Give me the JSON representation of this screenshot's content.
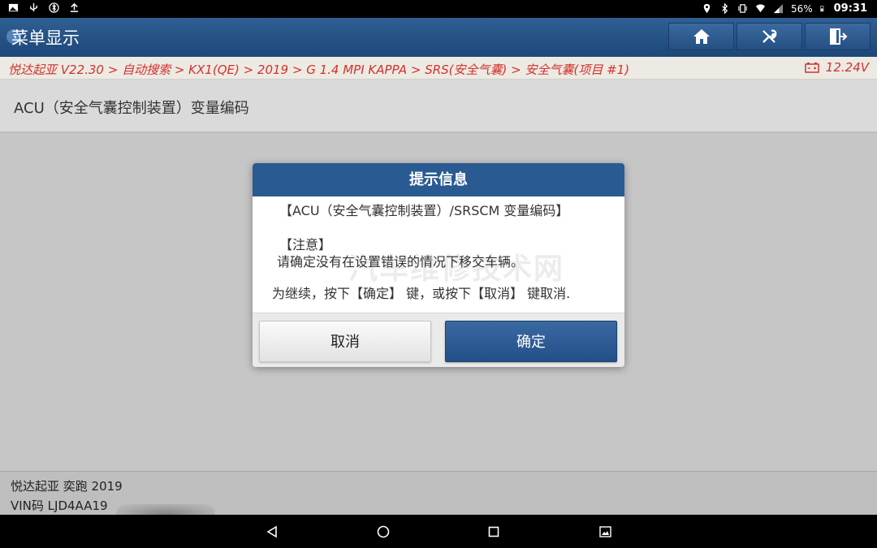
{
  "status_bar": {
    "battery": "56%",
    "time": "09:31",
    "left_icons": [
      "image-icon",
      "usb-icon",
      "bluetooth-settings-icon",
      "upload-icon"
    ],
    "right_icons": [
      "location-icon",
      "bluetooth-icon",
      "vibrate-icon",
      "wifi-icon",
      "signal-icon",
      "battery-icon"
    ]
  },
  "header": {
    "title": "菜单显示",
    "buttons": [
      "home-icon",
      "diagnose-tools-icon",
      "exit-icon"
    ]
  },
  "breadcrumb": {
    "path": "悦达起亚 V22.30 > 自动搜索 > KX1(QE) > 2019 > G 1.4 MPI KAPPA > SRS(安全气囊) > 安全气囊(项目 #1)",
    "voltage": "12.24V"
  },
  "section": {
    "title": "ACU（安全气囊控制装置）变量编码"
  },
  "dialog": {
    "title": "提示信息",
    "line1": "【ACU（安全气囊控制装置）/SRSCM 变量编码】",
    "line2": "【注意】",
    "line3": "请确定没有在设置错误的情况下移交车辆。",
    "line4": "为继续，按下【确定】 键，或按下【取消】 键取消.",
    "watermark": "汽车维修技术网",
    "cancel_label": "取消",
    "ok_label": "确定"
  },
  "footer": {
    "vehicle": "悦达起亚 奕跑 2019",
    "vin": "VIN码 LJD4AA19"
  },
  "nav": [
    "back-icon",
    "home-circle-icon",
    "recents-icon",
    "screenshot-icon"
  ],
  "colors": {
    "header_blue": "#2a5a92",
    "breadcrumb_red": "#d2322e",
    "background_gray": "#c6c6c6"
  }
}
